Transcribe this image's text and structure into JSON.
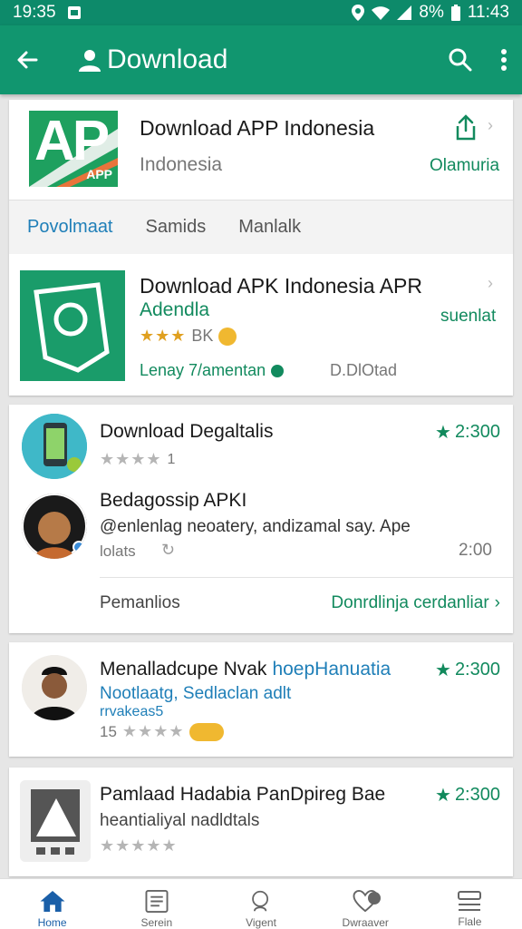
{
  "status_bar": {
    "time_left": "19:35",
    "battery": "8%",
    "time_right": "11:43"
  },
  "app_bar": {
    "title": "Download",
    "back_icon": "arrow-left-icon",
    "user_icon": "user-icon",
    "search_icon": "search-icon",
    "more_icon": "more-vertical-icon"
  },
  "featured": {
    "logo_text": "AP",
    "logo_badge": "APP",
    "title": "Download APP Indonesia",
    "subtitle": "Indonesia",
    "share_label": "Olamuria"
  },
  "tabs": [
    "Povolmaat",
    "Samids",
    "Manlalk"
  ],
  "app_card": {
    "title": "Download APK Indonesia APR",
    "subtitle": "Adendla",
    "side_label": "suenlat",
    "rating_text": "BK",
    "developer": "Lenay 7/amentan",
    "downloads": "D.DlOtad"
  },
  "list_card": {
    "items": [
      {
        "title": "Download Degaltalis",
        "rating": "2:300",
        "meta": "1",
        "stars_filled": 0
      },
      {
        "title": "Bedagossip APKI",
        "desc": "@enlenlag neoatery, andizamal say. Ape",
        "meta": "lolats",
        "count": "2:00"
      }
    ],
    "footer_left": "Pemanlios",
    "footer_right": "Donrdlinja cerdanliar"
  },
  "card3": {
    "title": "Menalladcupe Nvak",
    "title_extra": "hoepHanuatia",
    "subtitle": "Nootlaatg, Sedlaclan adlt",
    "subtitle2": "rrvakeas5",
    "rating": "2:300",
    "rating_count": "15"
  },
  "card4": {
    "title": "Pamlaad Hadabia PanDpireg Bae",
    "subtitle": "heantialiyal nadldtals",
    "rating": "2:300"
  },
  "bottom_nav": [
    {
      "label": "Home",
      "icon": "home-icon"
    },
    {
      "label": "Serein",
      "icon": "list-icon"
    },
    {
      "label": "Vigent",
      "icon": "search-icon"
    },
    {
      "label": "Dwraaver",
      "icon": "heart-icon"
    },
    {
      "label": "Flale",
      "icon": "menu-icon"
    }
  ],
  "colors": {
    "primary": "#11966f",
    "status": "#0d8a6a",
    "accent_green": "#128a5e",
    "link_blue": "#1f7fb8"
  }
}
